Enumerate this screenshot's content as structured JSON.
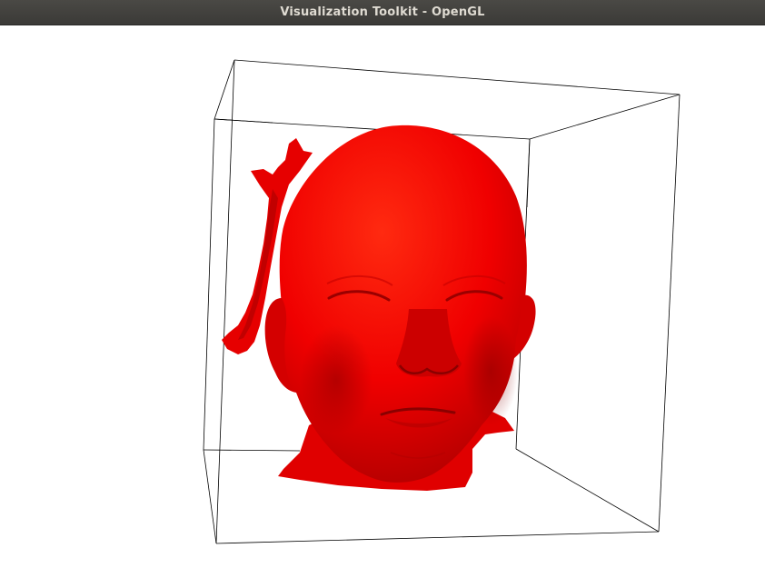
{
  "window": {
    "title": "Visualization Toolkit - OpenGL"
  },
  "scene": {
    "background_color": "#ffffff",
    "surface_color": "#ff0000",
    "outline_color": "#000000"
  }
}
